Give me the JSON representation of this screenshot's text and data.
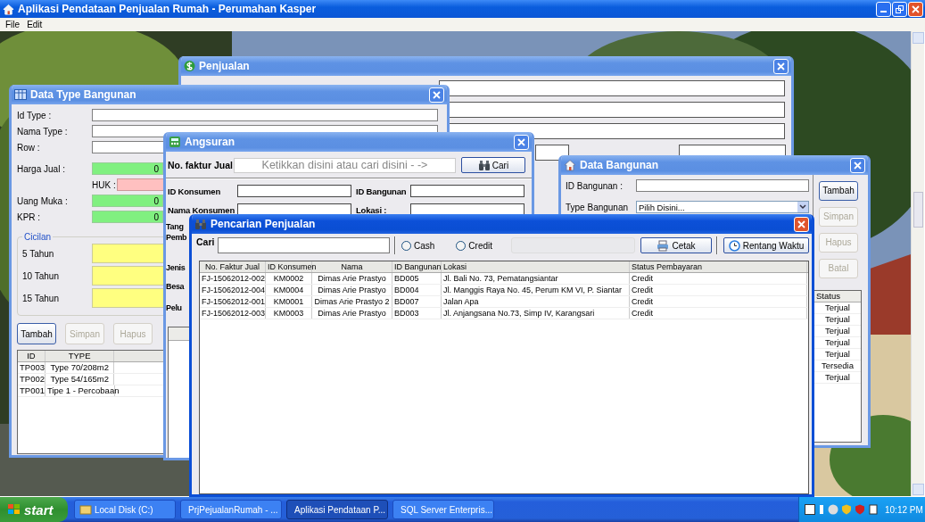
{
  "window": {
    "title": "Aplikasi Pendataan Penjualan Rumah - Perumahan Kasper"
  },
  "menu": [
    "File",
    "Edit"
  ],
  "penjualan": {
    "title": "Penjualan",
    "active": false
  },
  "data_type_bangunan": {
    "title": "Data Type Bangunan",
    "active": false,
    "fields": [
      {
        "kind": "text",
        "label": "Id Type :"
      },
      {
        "kind": "text",
        "label": "Nama Type :"
      },
      {
        "kind": "text",
        "label": "Row :"
      },
      {
        "kind": "amount",
        "label": "Harga Jual :",
        "value": "0"
      },
      {
        "kind": "huk",
        "label": "HUK :"
      },
      {
        "kind": "amount",
        "label": "Uang Muka :",
        "value": "0"
      },
      {
        "kind": "amount",
        "label": "KPR :",
        "value": "0"
      }
    ],
    "cicilan": {
      "legend": "Cicilan",
      "rows": [
        "5 Tahun",
        "10 Tahun",
        "15 Tahun"
      ]
    },
    "buttons": [
      {
        "label": "Tambah",
        "disabled": false
      },
      {
        "label": "Simpan",
        "disabled": true
      },
      {
        "label": "Hapus",
        "disabled": true
      }
    ],
    "table": {
      "columns": [
        "ID",
        "TYPE"
      ],
      "rows": [
        [
          "TP003",
          "Type 70/208m2"
        ],
        [
          "TP002",
          "Type 54/165m2"
        ],
        [
          "TP001",
          "Tipe 1 - Percobaan"
        ]
      ]
    }
  },
  "angsuran": {
    "title": "Angsuran",
    "active": false,
    "faktur_label": "No. faktur Jual",
    "faktur_placeholder": "Ketikkan disini atau cari disini - ->",
    "search_button": "Cari",
    "fields": [
      {
        "label": "ID Konsumen"
      },
      {
        "label": "ID Bangunan"
      },
      {
        "label": "Nama Konsumen"
      },
      {
        "label": "Lokasi :"
      }
    ],
    "cut_labels": [
      [
        "Tang",
        "Pemb"
      ],
      [
        "Jenis"
      ],
      [
        "Besa"
      ],
      [
        "Pelu"
      ]
    ]
  },
  "data_bangunan": {
    "title": "Data Bangunan",
    "active": false,
    "fields": [
      {
        "kind": "text",
        "label": "ID Bangunan :"
      },
      {
        "kind": "select",
        "label": "Type Bangunan",
        "value": "Pilih Disini..."
      }
    ],
    "buttons": [
      {
        "label": "Tambah",
        "disabled": false
      },
      {
        "label": "Simpan",
        "disabled": true
      },
      {
        "label": "Hapus",
        "disabled": true
      },
      {
        "label": "Batal",
        "disabled": true
      }
    ],
    "status_table": {
      "column": "Status",
      "rows": [
        "Terjual",
        "Terjual",
        "Terjual",
        "Terjual",
        "Terjual",
        "Tersedia",
        "Terjual"
      ]
    }
  },
  "pencarian": {
    "title": "Pencarian Penjualan",
    "active": true,
    "search_label": "Cari",
    "filters": [
      {
        "label": "Cash",
        "selected": false
      },
      {
        "label": "Credit",
        "selected": false
      }
    ],
    "print_button": "Cetak",
    "range_button": "Rentang Waktu",
    "table": {
      "columns": [
        "No. Faktur Jual",
        "ID Konsumen",
        "Nama",
        "ID Bangunan",
        "Lokasi",
        "Status Pembayaran"
      ],
      "rows": [
        [
          "FJ-15062012-002",
          "KM0002",
          "Dimas Arie Prastyo",
          "BD005",
          "Jl. Bali No. 73, Pematangsiantar",
          "Credit"
        ],
        [
          "FJ-15062012-004",
          "KM0004",
          "Dimas Arie Prastyo",
          "BD004",
          "Jl. Manggis Raya No. 45, Perum KM VI, P. Siantar",
          "Credit"
        ],
        [
          "FJ-15062012-001",
          "KM0001",
          "Dimas Arie Prastyo 2",
          "BD007",
          "Jalan Apa",
          "Credit"
        ],
        [
          "FJ-15062012-003",
          "KM0003",
          "Dimas Arie Prastyo",
          "BD003",
          "Jl. Anjangsana No.73, Simp IV, Karangsari",
          "Credit"
        ]
      ]
    }
  },
  "taskbar": {
    "start": "start",
    "items": [
      {
        "label": "Local Disk (C:)",
        "selected": false
      },
      {
        "label": "PrjPejualanRumah - ...",
        "selected": false
      },
      {
        "label": "Aplikasi Pendataan P...",
        "selected": true
      },
      {
        "label": "SQL Server Enterpris...",
        "selected": false
      }
    ],
    "clock": "10:12 PM"
  }
}
